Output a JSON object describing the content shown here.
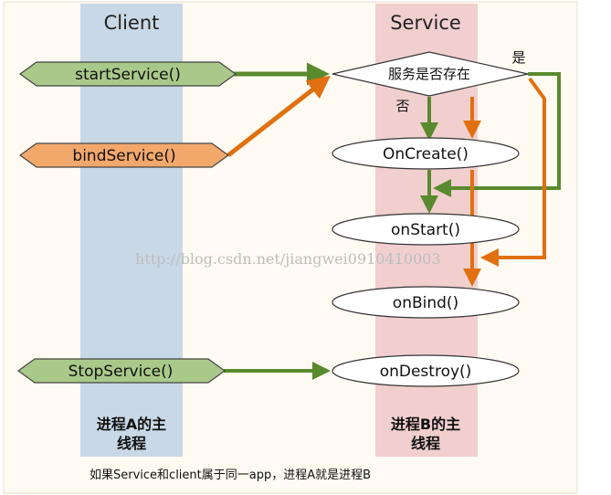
{
  "lanes": {
    "client": {
      "title": "Client",
      "footer_line1": "进程A的主",
      "footer_line2": "线程",
      "color": "#c9d8e6"
    },
    "service": {
      "title": "Service",
      "footer_line1": "进程B的主",
      "footer_line2": "线程",
      "color": "#f1cfcf"
    }
  },
  "client_nodes": {
    "start_service": {
      "label": "startService()",
      "color": "#a9c98a"
    },
    "bind_service": {
      "label": "bindService()",
      "color": "#f3a86b"
    },
    "stop_service": {
      "label": "StopService()",
      "color": "#a9c98a"
    }
  },
  "service_nodes": {
    "decision": {
      "label": "服务是否存在",
      "yes": "是",
      "no": "否"
    },
    "on_create": "OnCreate()",
    "on_start": "onStart()",
    "on_bind": "onBind()",
    "on_destroy": "onDestroy()"
  },
  "arrow_colors": {
    "start_path": "#5a8a2e",
    "bind_path": "#e07010"
  },
  "watermark": "http://blog.csdn.net/jiangwei0910410003",
  "footer_note": "如果Service和client属于同一app，进程A就是进程B"
}
